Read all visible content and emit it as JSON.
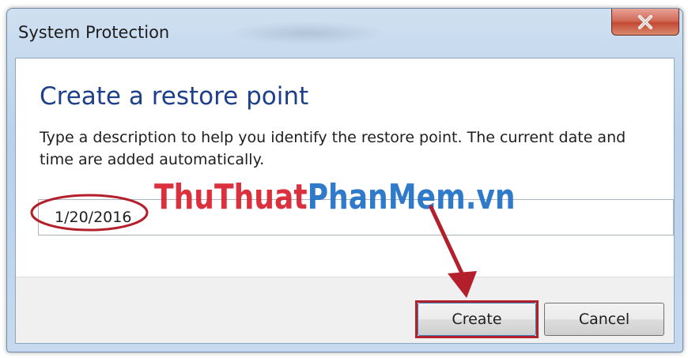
{
  "window": {
    "title": "System Protection",
    "close_glyph": "close-icon"
  },
  "content": {
    "heading": "Create a restore point",
    "description": "Type a description to help you identify the restore point. The current date and time are added automatically.",
    "input_value": "1/20/2016"
  },
  "buttons": {
    "create_label": "Create",
    "cancel_label": "Cancel"
  },
  "watermark": {
    "part1": "ThuThuat",
    "part2": "PhanMem.vn"
  },
  "colors": {
    "heading": "#1e3f8a",
    "annotation": "#b31f2a",
    "watermark_red": "#d91f2d",
    "watermark_blue": "#1f6fc6"
  }
}
